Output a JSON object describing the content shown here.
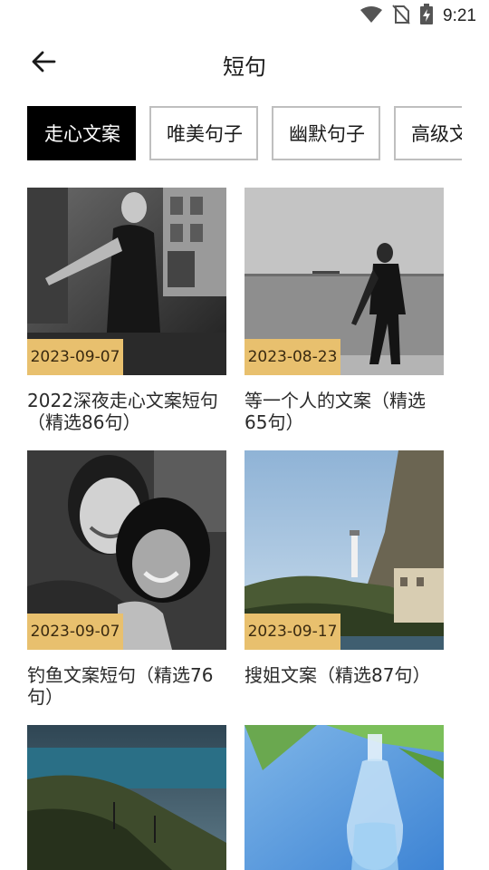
{
  "status_bar": {
    "time": "9:21",
    "icons": [
      "wifi-icon",
      "no-sim-icon",
      "battery-charging-icon"
    ]
  },
  "app_bar": {
    "title": "短句",
    "back_icon": "arrow-left-icon"
  },
  "tabs": [
    {
      "label": "走心文案",
      "active": true
    },
    {
      "label": "唯美句子",
      "active": false
    },
    {
      "label": "幽默句子",
      "active": false
    },
    {
      "label": "高级文",
      "active": false
    }
  ],
  "cards": [
    {
      "date": "2023-09-07",
      "title": "2022深夜走心文案短句（精选86句）",
      "image": "black-and-white photo of woman on street"
    },
    {
      "date": "2023-08-23",
      "title": "等一个人的文案（精选65句）",
      "image": "black-and-white photo of woman walking by the sea"
    },
    {
      "date": "2023-09-07",
      "title": "钓鱼文案短句（精选76句）",
      "image": "black-and-white photo of two smiling women"
    },
    {
      "date": "2023-09-17",
      "title": "搜姐文案（精选87句）",
      "image": "coastal cliffs with lighthouse"
    },
    {
      "date": "",
      "title": "",
      "image": "forest hills over lake"
    },
    {
      "date": "",
      "title": "",
      "image": "glass bottle with palm leaves on blue"
    }
  ],
  "colors": {
    "badge": "#e8c06e",
    "active_tab": "#000000",
    "tab_border": "#bfbfbf"
  }
}
